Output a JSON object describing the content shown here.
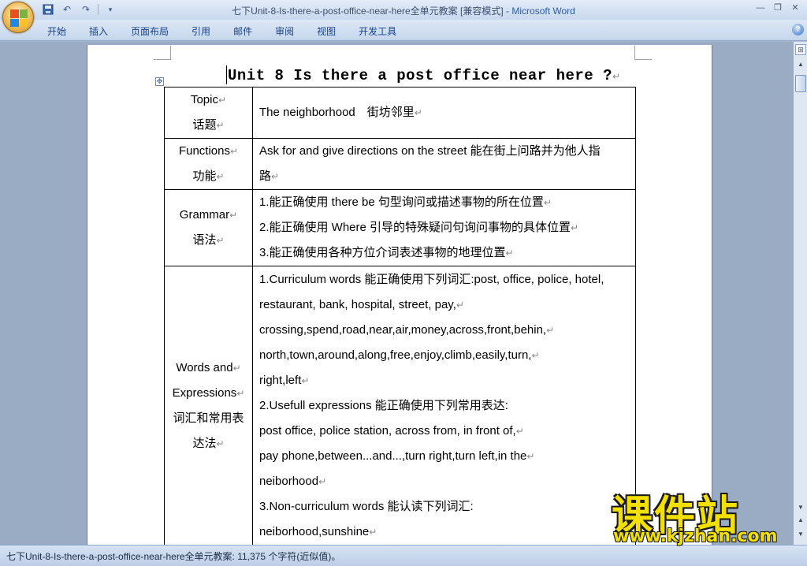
{
  "window": {
    "title": "七下Unit-8-Is-there-a-post-office-near-here全单元教案 [兼容模式] - ",
    "app_name": "Microsoft Word"
  },
  "quick_access": {
    "save_icon": "save-icon",
    "undo_icon": "undo-icon",
    "redo_icon": "redo-icon",
    "customize_icon": "customize-icon"
  },
  "ribbon": {
    "tabs": [
      "开始",
      "插入",
      "页面布局",
      "引用",
      "邮件",
      "审阅",
      "视图",
      "开发工具"
    ],
    "help_label": "?"
  },
  "document": {
    "title": "Unit 8 Is there a post office near here ?",
    "mark": "↵",
    "rows": [
      {
        "label_lines": [
          "Topic",
          "话题"
        ],
        "content_lines": [
          "The neighborhood　街坊邻里"
        ]
      },
      {
        "label_lines": [
          "Functions",
          "功能"
        ],
        "content_lines": [
          "Ask for and give directions on the street 能在街上问路并为他人指",
          "路"
        ]
      },
      {
        "label_lines": [
          "Grammar",
          "语法"
        ],
        "content_lines": [
          "1.能正确使用 there be  句型询问或描述事物的所在位置",
          "2.能正确使用 Where 引导的特殊疑问句询问事物的具体位置",
          "3.能正确使用各种方位介词表述事物的地理位置"
        ]
      },
      {
        "label_lines": [
          "Words and",
          "Expressions",
          "词汇和常用表",
          "达法"
        ],
        "content_lines": [
          "1.Curriculum words 能正确使用下列词汇:post, office, police, hotel,",
          "restaurant, bank, hospital, street, pay,",
          "crossing,spend,road,near,air,money,across,front,behin,",
          "north,town,around,along,free,enjoy,climb,easily,turn,",
          "right,left",
          "2.Usefull expressions 能正确使用下列常用表达:",
          "post office, police station, across from, in front of,",
          "pay phone,between...and...,turn  right,turn left,in the",
          "neiborhood",
          "3.Non-curriculum words 能认读下列词汇:",
          "neiborhood,sunshine"
        ]
      }
    ]
  },
  "statusbar": {
    "text": "七下Unit-8-Is-there-a-post-office-near-here全单元教案: 11,375 个字符(近似值)。"
  },
  "watermark": {
    "cn": "课件站",
    "url": "www.kjzhan.com"
  }
}
